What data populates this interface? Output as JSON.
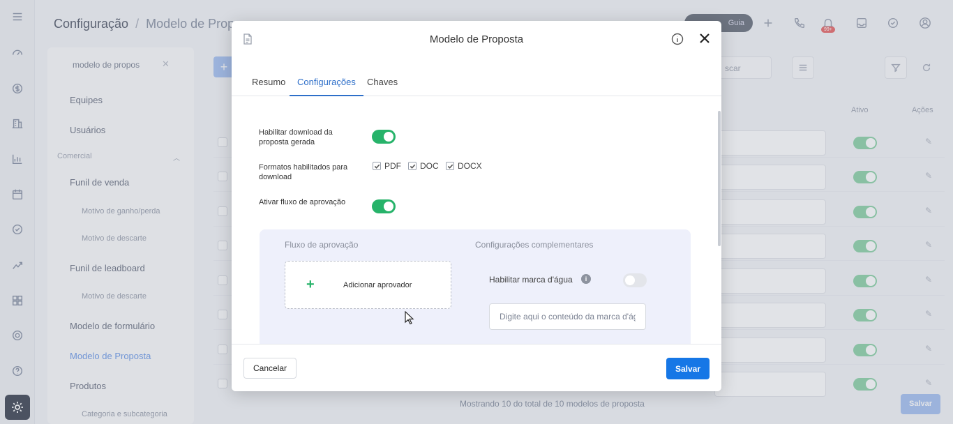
{
  "background": {
    "breadcrumb": {
      "root": "Configuração",
      "separator": "/",
      "current": "Modelo de Propo"
    },
    "guide_button": "Guia",
    "notification_badge": "99+",
    "sidebar": {
      "search_value": "modelo de propos",
      "items": {
        "equipes": "Equipes",
        "usuarios": "Usuários",
        "group_comercial": "Comercial",
        "funil_venda": "Funil de venda",
        "motivo_ganho": "Motivo de ganho/perda",
        "motivo_descarte_1": "Motivo de descarte",
        "funil_leadboard": "Funil de leadboard",
        "motivo_descarte_2": "Motivo de descarte",
        "modelo_formulario": "Modelo de formulário",
        "modelo_proposta": "Modelo de Proposta",
        "produtos": "Produtos",
        "categoria": "Categoria e subcategoria"
      }
    },
    "search_placeholder": "scar",
    "columns": {
      "ativo": "Ativo",
      "acoes": "Ações"
    },
    "footer_text": "Mostrando 10 do total de 10 modelos de proposta",
    "save_label": "Salvar"
  },
  "modal": {
    "title": "Modelo de Proposta",
    "tabs": {
      "resumo": "Resumo",
      "configuracoes": "Configurações",
      "chaves": "Chaves"
    },
    "active_tab": "Configurações",
    "fields": {
      "download_label": "Habilitar download da proposta gerada",
      "download_enabled": true,
      "formats_label": "Formatos habilitados para download",
      "formats": {
        "pdf": "PDF",
        "doc": "DOC",
        "docx": "DOCX"
      },
      "approval_label": "Ativar fluxo de aprovação",
      "approval_enabled": true
    },
    "panel": {
      "approval_flow_title": "Fluxo de aprovação",
      "complementary_title": "Configurações complementares",
      "add_approver": "Adicionar aprovador",
      "watermark_label": "Habilitar marca d'água",
      "watermark_enabled": false,
      "watermark_placeholder": "Digite aqui o conteúdo da marca d'água"
    },
    "footer": {
      "cancel": "Cancelar",
      "save": "Salvar"
    }
  },
  "colors": {
    "toggle_on": "#27b36a",
    "primary": "#1677e6",
    "active_tab": "#2e6fc9"
  }
}
